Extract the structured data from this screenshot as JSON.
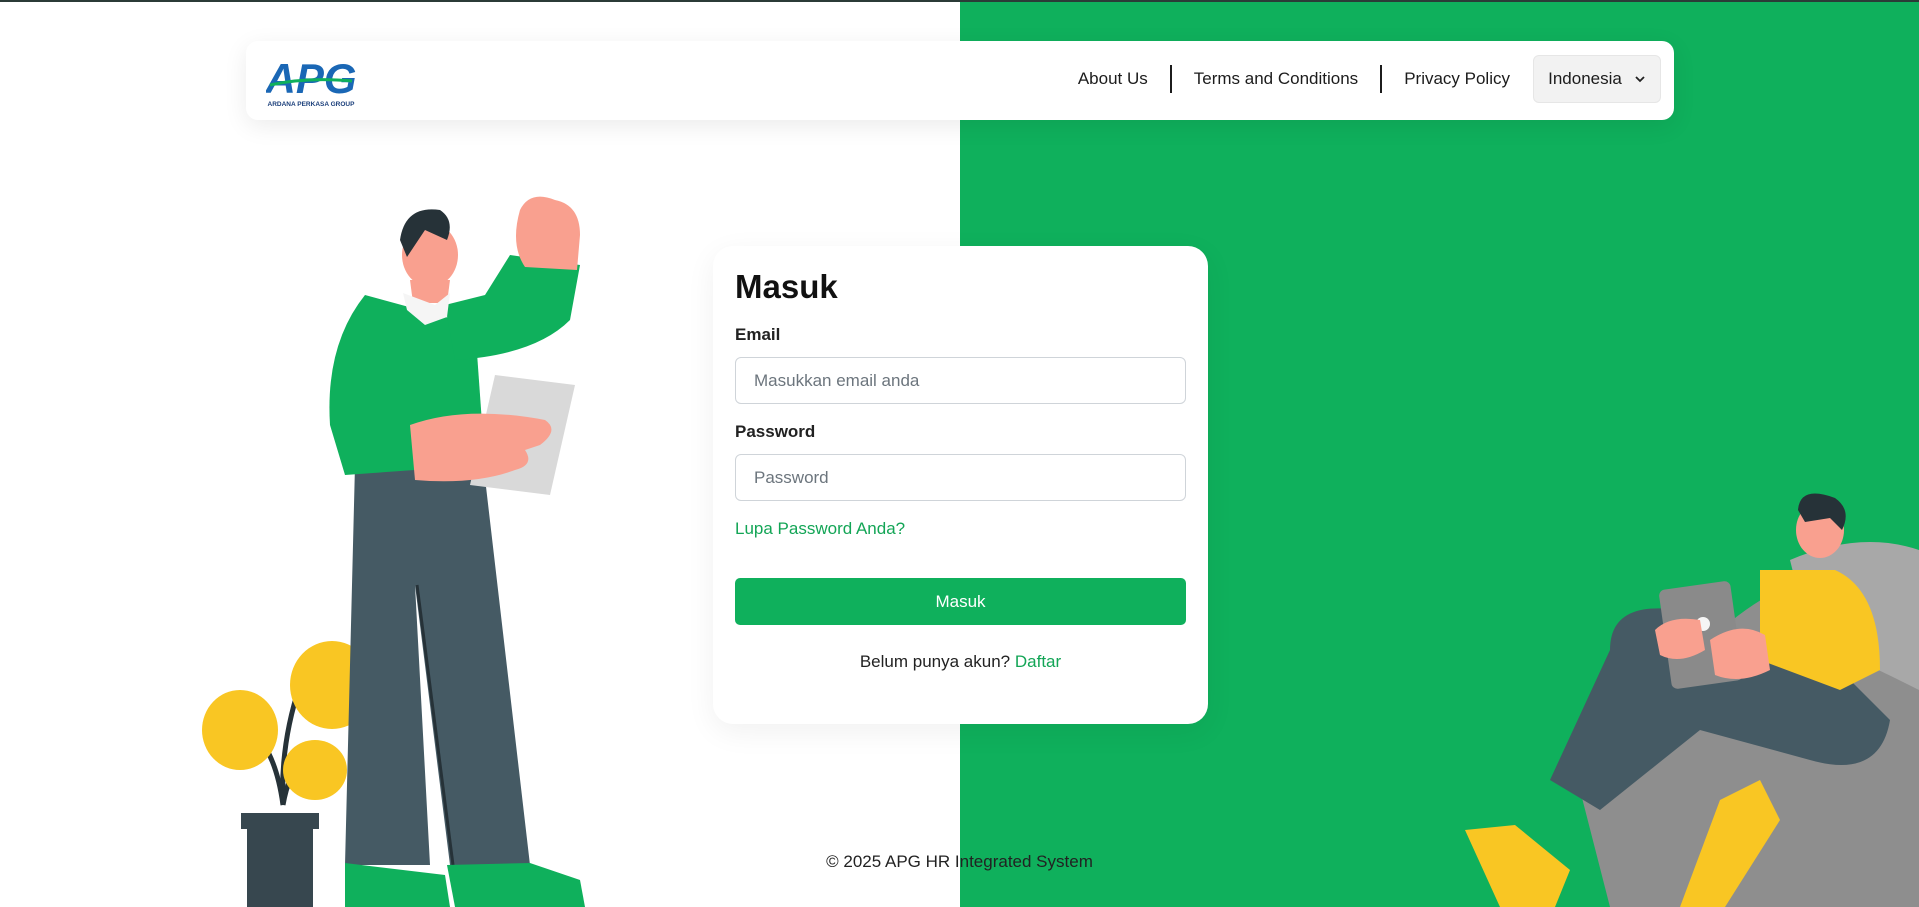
{
  "header": {
    "logo_text": "APG",
    "logo_subtitle": "ARDANA PERKASA GROUP",
    "nav": [
      "About Us",
      "Terms and Conditions",
      "Privacy Policy"
    ],
    "language": "Indonesia"
  },
  "login": {
    "title": "Masuk",
    "email_label": "Email",
    "email_placeholder": "Masukkan email anda",
    "email_value": "",
    "password_label": "Password",
    "password_placeholder": "Password",
    "password_value": "",
    "forgot_label": "Lupa Password Anda?",
    "submit_label": "Masuk",
    "register_prompt": "Belum punya akun?",
    "register_link": "Daftar"
  },
  "footer": {
    "copyright": "© 2025 APG HR Integrated System"
  },
  "colors": {
    "brand_green": "#0fb05c",
    "link_green": "#13a556",
    "accent_yellow": "#f9c623",
    "pants_gray": "#455a64"
  }
}
